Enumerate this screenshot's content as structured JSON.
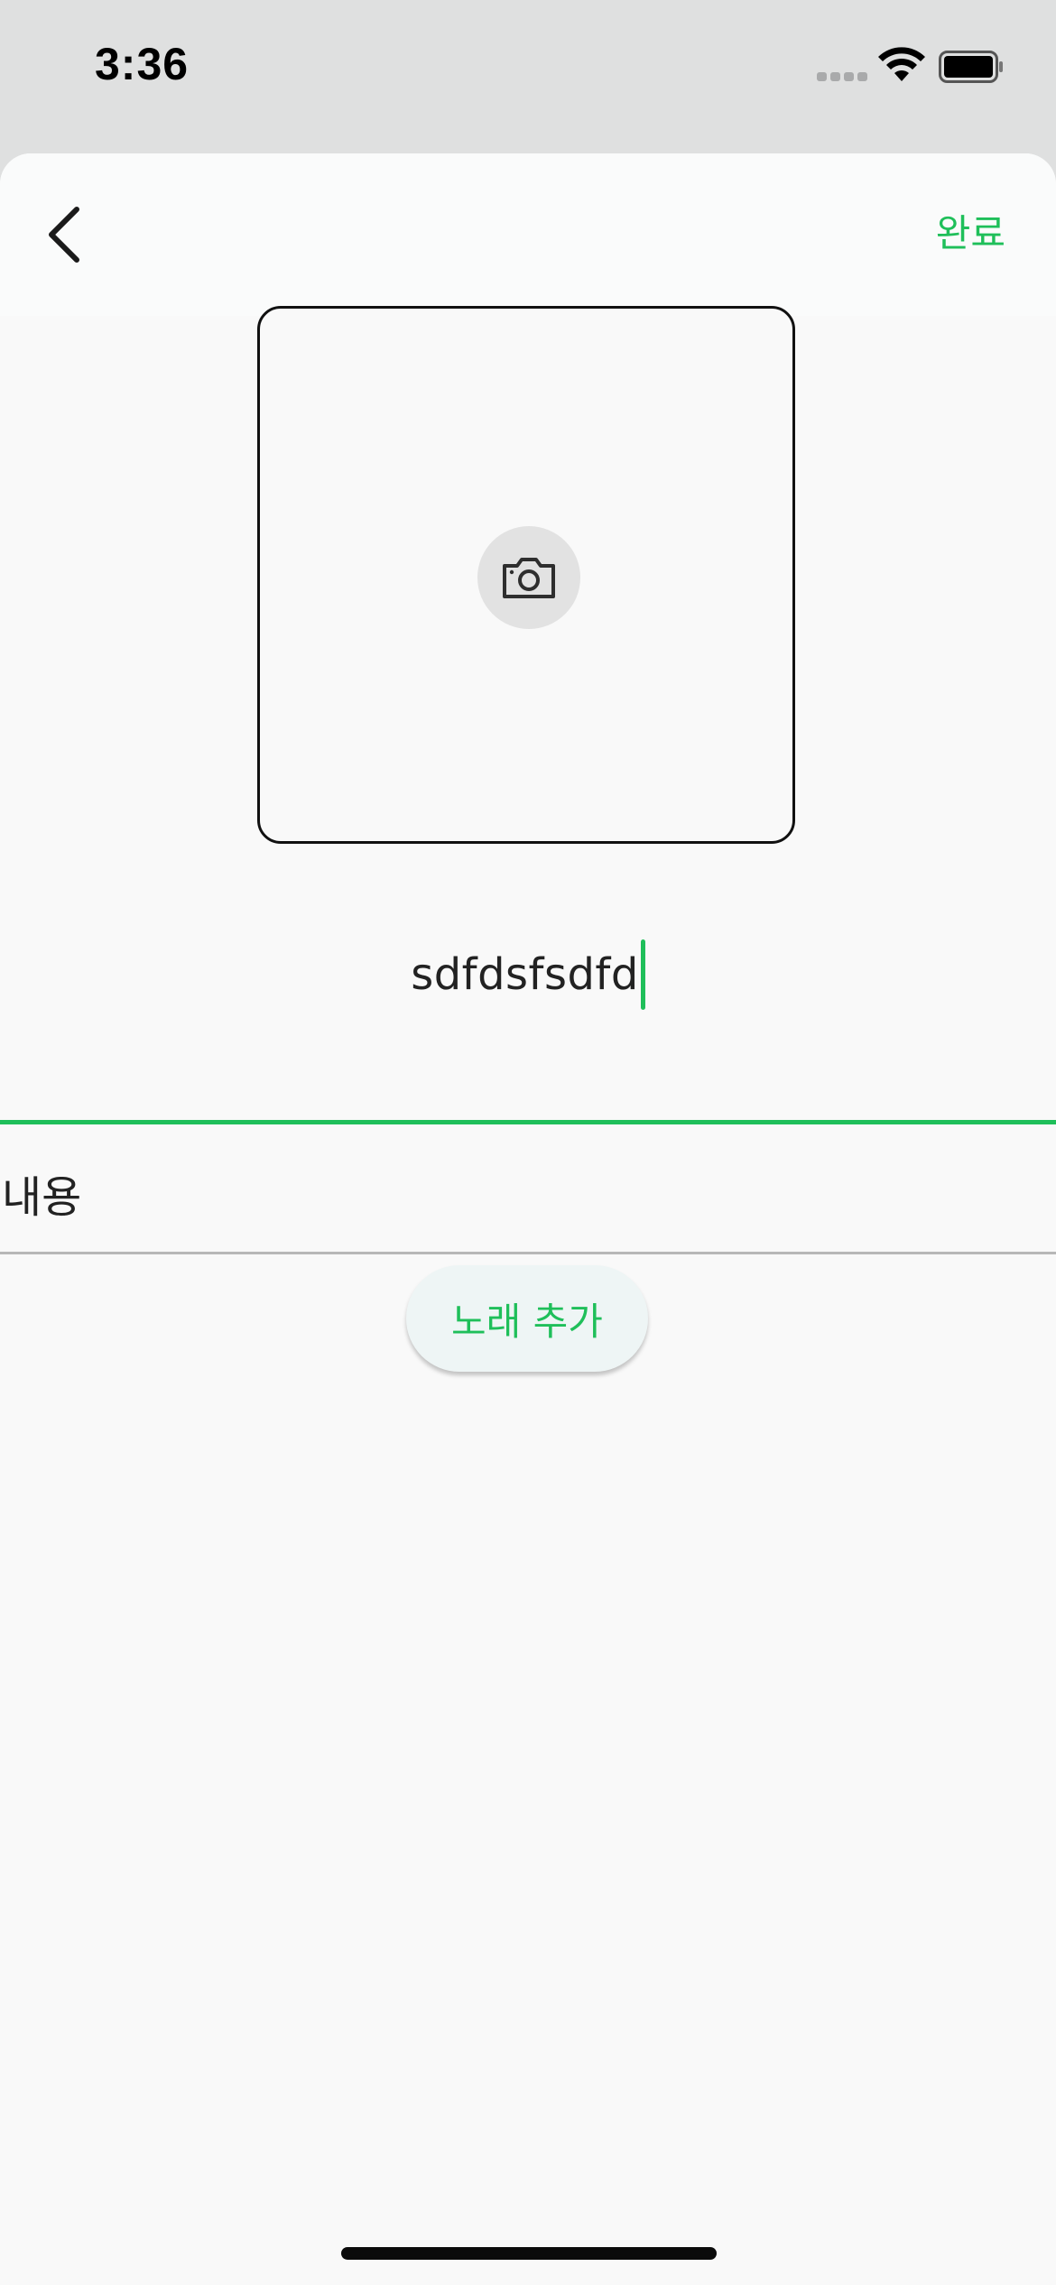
{
  "status_bar": {
    "time": "3:36",
    "signal_icon": "cellular-signal-icon",
    "wifi_icon": "wifi-icon",
    "battery_icon": "battery-icon"
  },
  "header": {
    "back_icon": "chevron-left-icon",
    "done_label": "완료"
  },
  "photo": {
    "camera_icon": "camera-icon"
  },
  "form": {
    "title_value": "sdfdsfsdfd",
    "content_placeholder": "내용"
  },
  "actions": {
    "add_song_label": "노래 추가"
  },
  "colors": {
    "accent": "#1fbf5a",
    "background": "#f9f9f9",
    "status_bar": "#dfe0e0"
  }
}
